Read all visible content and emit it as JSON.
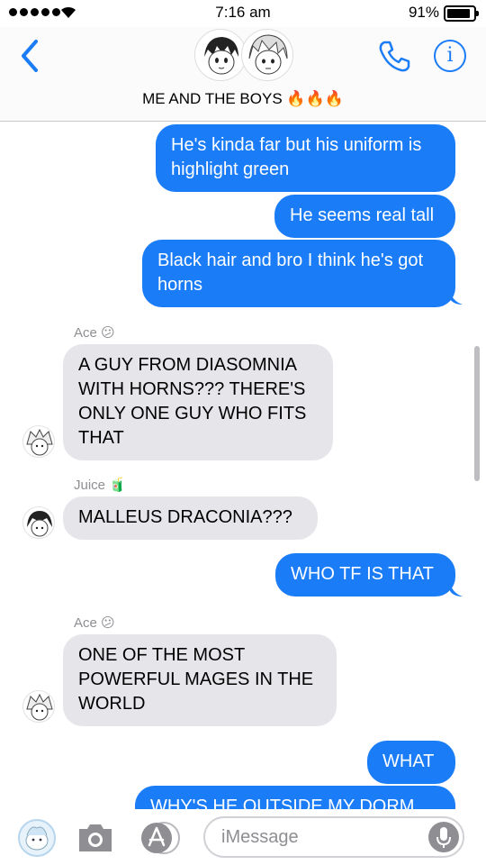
{
  "status_bar": {
    "time": "7:16 am",
    "battery_percent": "91%",
    "battery_level": 0.91,
    "signal_bars": 5
  },
  "header": {
    "back_icon": "chevron-left-icon",
    "group_title": "ME AND THE BOYS 🔥🔥🔥",
    "call_icon": "phone-icon",
    "info_icon": "info-icon",
    "info_glyph": "i"
  },
  "messages": [
    {
      "direction": "outgoing",
      "text": "He's kinda far but his uniform is highlight green"
    },
    {
      "direction": "outgoing",
      "text": "He seems real tall"
    },
    {
      "direction": "outgoing",
      "text": "Black hair and bro I think he's got horns"
    },
    {
      "direction": "incoming",
      "sender": "Ace 😕",
      "text": "A GUY FROM DIASOMNIA WITH HORNS??? THERE'S ONLY ONE GUY WHO FITS THAT"
    },
    {
      "direction": "incoming",
      "sender": "Juice 🧃",
      "text": "MALLEUS DRACONIA???"
    },
    {
      "direction": "outgoing",
      "text": "WHO TF IS THAT"
    },
    {
      "direction": "incoming",
      "sender": "Ace 😕",
      "text": "ONE OF THE MOST POWERFUL MAGES IN THE WORLD"
    },
    {
      "direction": "outgoing",
      "text": "WHAT"
    },
    {
      "direction": "outgoing",
      "text": "WHY'S HE OUTSIDE MY DORM"
    }
  ],
  "input_bar": {
    "placeholder": "iMessage",
    "icons": [
      "sticker-app-icon",
      "camera-icon",
      "app-store-icon",
      "microphone-icon"
    ]
  },
  "colors": {
    "outgoing_bubble": "#1a7cf6",
    "incoming_bubble": "#e6e5ea",
    "accent": "#1a7cf6"
  }
}
